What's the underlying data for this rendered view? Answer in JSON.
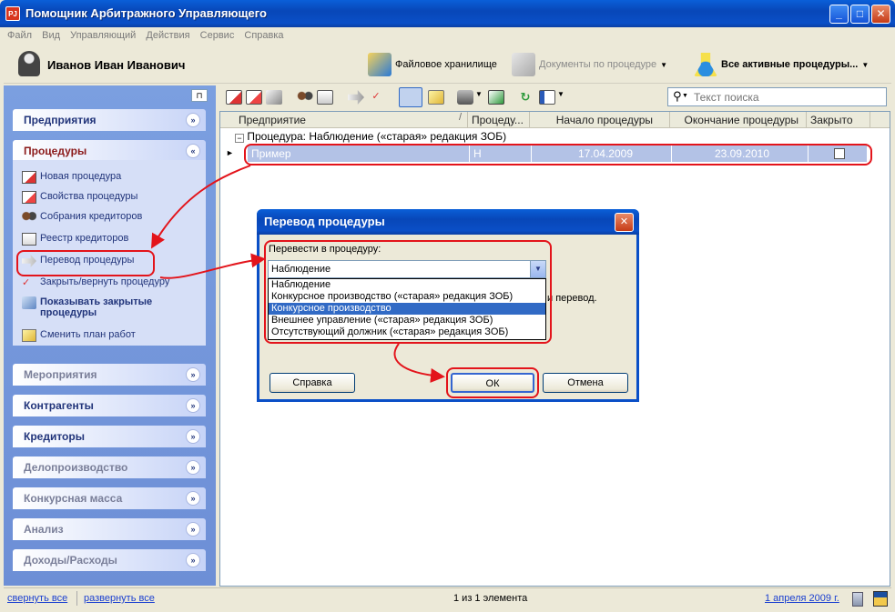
{
  "window": {
    "title": "Помощник Арбитражного Управляющего",
    "icon_text": "PJ"
  },
  "menu": [
    "Файл",
    "Вид",
    "Управляющий",
    "Действия",
    "Сервис",
    "Справка"
  ],
  "userbar": {
    "user_name": "Иванов Иван Иванович",
    "file_storage": "Файловое хранилище",
    "docs_by_procedure": "Документы по процедуре",
    "active_procedures": "Все активные процедуры..."
  },
  "sidebar": {
    "enterprises": "Предприятия",
    "procedures": "Процедуры",
    "tasks": [
      "Новая процедура",
      "Свойства процедуры",
      "Собрания кредиторов",
      "Реестр кредиторов",
      "Перевод процедуры",
      "Закрыть/вернуть процедуру",
      "Показывать закрытые процедуры",
      "Сменить план работ"
    ],
    "sections": [
      "Мероприятия",
      "Контрагенты",
      "Кредиторы",
      "Делопроизводство",
      "Конкурсная масса",
      "Анализ",
      "Доходы/Расходы"
    ]
  },
  "search": {
    "placeholder": "Текст поиска"
  },
  "grid": {
    "columns": [
      "Предприятие",
      "Процеду...",
      "Начало процедуры",
      "Окончание процедуры",
      "Закрыто"
    ],
    "group": "Процедура: Наблюдение («старая» редакция ЗОБ)",
    "row": {
      "enterprise": "Пример",
      "procedure": "Н",
      "start": "17.04.2009",
      "end": "23.09.2010",
      "closed": false
    }
  },
  "statusbar": {
    "collapse_all": "свернуть все",
    "expand_all": "развернуть все",
    "count": "1 из 1 элемента",
    "date": "1 апреля 2009 г."
  },
  "dialog": {
    "title": "Перевод процедуры",
    "label": "Перевести в процедуру:",
    "selected": "Наблюдение",
    "options": [
      "Наблюдение",
      "Конкурсное производство («старая» редакция ЗОБ)",
      "Конкурсное производство",
      "Внешнее управление («старая» редакция ЗОБ)",
      "Отсутствующий должник («старая» редакция ЗОБ)"
    ],
    "highlighted_index": 2,
    "hint_tail": "и перевод.",
    "help": "Справка",
    "ok": "ОК",
    "cancel": "Отмена"
  },
  "colors": {
    "accent": "#0a4fc7",
    "annotation": "#e3141b",
    "row_select": "#b3c2e6"
  }
}
